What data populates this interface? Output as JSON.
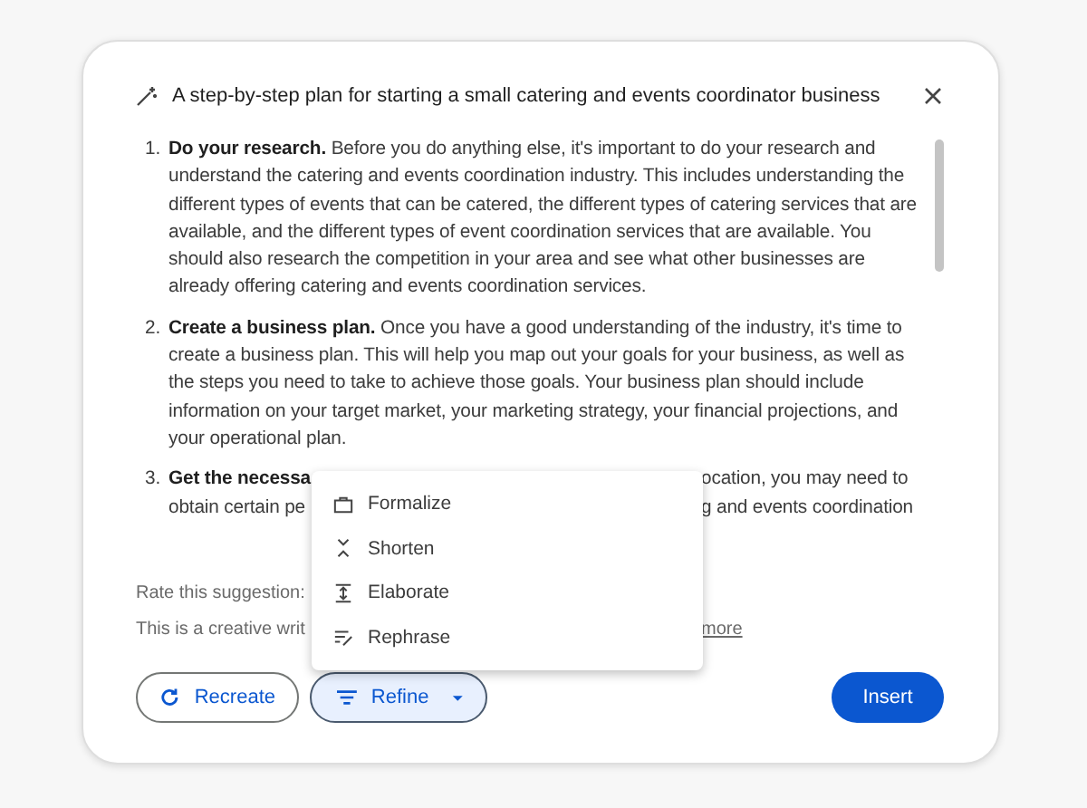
{
  "header": {
    "title": "A step-by-step plan for starting a small catering and events coordinator business"
  },
  "steps": [
    {
      "number": "1.",
      "heading": "Do your research.",
      "body": "Before you do anything else, it's important to do your research and understand the catering and events coordination industry. This includes understanding the different types of events that can be catered, the different types of catering services that are available, and the different types of event coordination services that are available. You should also research the competition in your area and see what other businesses are already offering catering and events coordination services."
    },
    {
      "number": "2.",
      "heading": "Create a business plan.",
      "body": "Once you have a good understanding of the industry, it's time to create a business plan. This will help you map out your goals for your business, as well as the steps you need to take to achieve those goals. Your business plan should include information on your target market, your marketing strategy, your financial projections, and your operational plan."
    }
  ],
  "partial_step": {
    "number": "3.",
    "heading": "Get the necessa",
    "line_1_end": "ocation, you may need to",
    "line_2_start": "obtain certain pe",
    "line_2_end": "g and events coordination"
  },
  "rating": {
    "label": "Rate this suggestion:"
  },
  "disclaimer": {
    "start": "This is a creative writ",
    "link": "more"
  },
  "refine_menu": {
    "items": [
      {
        "label": "Formalize"
      },
      {
        "label": "Shorten"
      },
      {
        "label": "Elaborate"
      },
      {
        "label": "Rephrase"
      }
    ]
  },
  "buttons": {
    "recreate": "Recreate",
    "refine": {
      "label": "Refine",
      "expanded": true
    },
    "insert": "Insert"
  }
}
